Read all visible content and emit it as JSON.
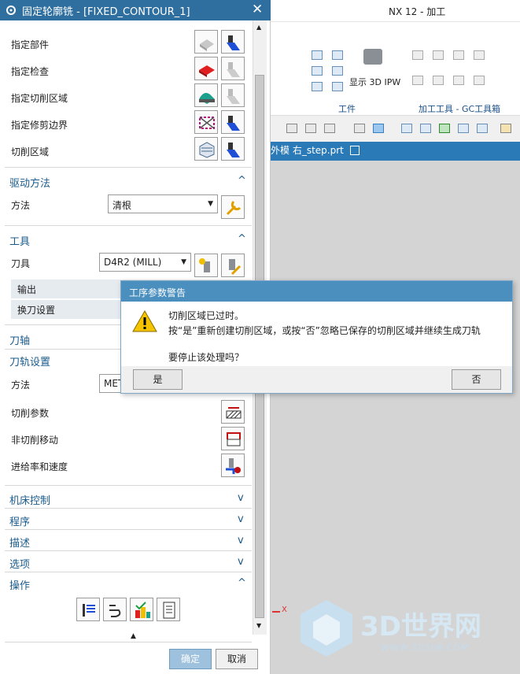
{
  "nx": {
    "title": "NX 12 - 加工",
    "ribbon": {
      "show_ipw": "显示 3D IPW",
      "group_workpiece": "工件",
      "group_tools": "加工工具 - GC工具箱"
    },
    "tab": "外模  右_step.prt",
    "axis_label": "X"
  },
  "dialog": {
    "title": "固定轮廓铣 - [FIXED_CONTOUR_1]",
    "geometry_rows": [
      "指定部件",
      "指定检查",
      "指定切削区域",
      "指定修剪边界",
      "切削区域"
    ],
    "drive": {
      "title": "驱动方法",
      "method_label": "方法",
      "method_value": "清根"
    },
    "tool": {
      "title": "工具",
      "tool_label": "刀具",
      "tool_value": "D4R2 (MILL)",
      "output": "输出",
      "tool_change": "换刀设置"
    },
    "tool_axis": "刀轴",
    "path": {
      "title": "刀轨设置",
      "method_label": "方法",
      "method_value": "MET",
      "cut_params": "切削参数",
      "non_cut": "非切削移动",
      "feeds": "进给率和速度"
    },
    "collapsed": [
      "机床控制",
      "程序",
      "描述",
      "选项"
    ],
    "ops": "操作",
    "ok": "确定",
    "cancel": "取消"
  },
  "warning": {
    "title": "工序参数警告",
    "line1": "切削区域已过时。",
    "line2": "按“是”重新创建切削区域，或按“否”忽略已保存的切削区域并继续生成刀轨",
    "line3": "要停止该处理吗？",
    "yes": "是",
    "no": "否"
  },
  "watermark": {
    "brand": "3D世界网",
    "url": "WWW.3DSJW.COM"
  }
}
